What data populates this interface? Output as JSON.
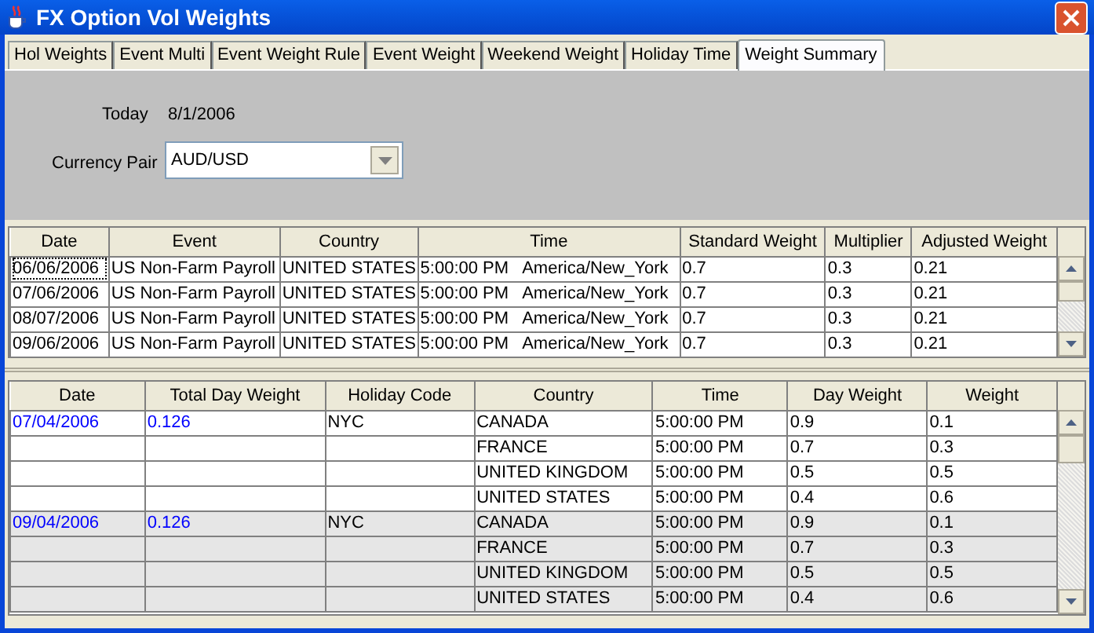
{
  "window": {
    "title": "FX Option Vol Weights"
  },
  "tabs": [
    {
      "label": "Hol Weights",
      "selected": false
    },
    {
      "label": "Event Multi",
      "selected": false
    },
    {
      "label": "Event Weight Rule",
      "selected": false
    },
    {
      "label": "Event Weight",
      "selected": false
    },
    {
      "label": "Weekend Weight",
      "selected": false
    },
    {
      "label": "Holiday Time",
      "selected": false
    },
    {
      "label": "Weight Summary",
      "selected": true
    }
  ],
  "today": {
    "label": "Today",
    "value": "8/1/2006"
  },
  "currency_pair": {
    "label": "Currency Pair",
    "value": "AUD/USD"
  },
  "events_table": {
    "columns": [
      "Date",
      "Event",
      "Country",
      "Time",
      "Standard Weight",
      "Multiplier",
      "Adjusted Weight"
    ],
    "rows": [
      {
        "focused": true,
        "cells": [
          "06/06/2006",
          "US Non-Farm Payroll",
          "UNITED STATES",
          "5:00:00 PM   America/New_York",
          "0.7",
          "0.3",
          "0.21"
        ]
      },
      {
        "focused": false,
        "cells": [
          "07/06/2006",
          "US Non-Farm Payroll",
          "UNITED STATES",
          "5:00:00 PM   America/New_York",
          "0.7",
          "0.3",
          "0.21"
        ]
      },
      {
        "focused": false,
        "cells": [
          "08/07/2006",
          "US Non-Farm Payroll",
          "UNITED STATES",
          "5:00:00 PM   America/New_York",
          "0.7",
          "0.3",
          "0.21"
        ]
      },
      {
        "focused": false,
        "cells": [
          "09/06/2006",
          "US Non-Farm Payroll",
          "UNITED STATES",
          "5:00:00 PM   America/New_York",
          "0.7",
          "0.3",
          "0.21"
        ]
      }
    ]
  },
  "summary_table": {
    "columns": [
      "Date",
      "Total Day Weight",
      "Holiday Code",
      "Country",
      "Time",
      "Day Weight",
      "Weight"
    ],
    "groups": [
      {
        "date": "07/04/2006",
        "total_day_weight": "0.126",
        "holiday_code": "NYC",
        "shaded": false,
        "rows": [
          {
            "country": "CANADA",
            "time": "5:00:00 PM",
            "day_weight": "0.9",
            "weight": "0.1"
          },
          {
            "country": "FRANCE",
            "time": "5:00:00 PM",
            "day_weight": "0.7",
            "weight": "0.3"
          },
          {
            "country": "UNITED KINGDOM",
            "time": "5:00:00 PM",
            "day_weight": "0.5",
            "weight": "0.5"
          },
          {
            "country": "UNITED STATES",
            "time": "5:00:00 PM",
            "day_weight": "0.4",
            "weight": "0.6"
          }
        ]
      },
      {
        "date": "09/04/2006",
        "total_day_weight": "0.126",
        "holiday_code": "NYC",
        "shaded": true,
        "rows": [
          {
            "country": "CANADA",
            "time": "5:00:00 PM",
            "day_weight": "0.9",
            "weight": "0.1"
          },
          {
            "country": "FRANCE",
            "time": "5:00:00 PM",
            "day_weight": "0.7",
            "weight": "0.3"
          },
          {
            "country": "UNITED KINGDOM",
            "time": "5:00:00 PM",
            "day_weight": "0.5",
            "weight": "0.5"
          },
          {
            "country": "UNITED STATES",
            "time": "5:00:00 PM",
            "day_weight": "0.4",
            "weight": "0.6"
          }
        ]
      }
    ]
  }
}
